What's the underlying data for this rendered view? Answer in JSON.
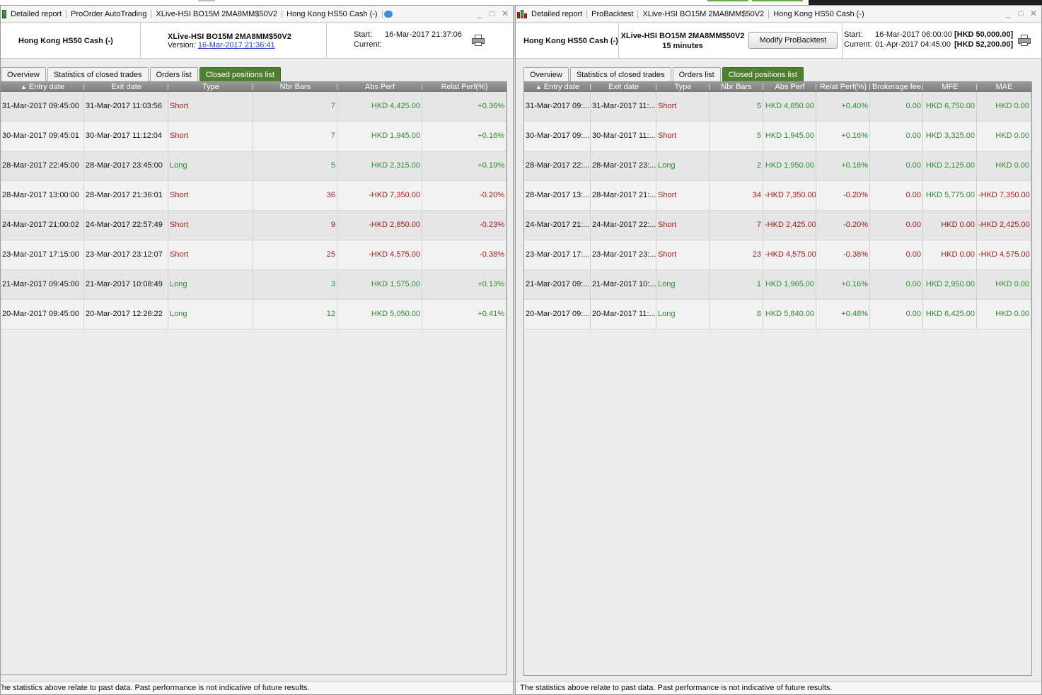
{
  "left": {
    "title_parts": [
      "Detailed report",
      "ProOrder AutoTrading",
      "XLive-HSI BO15M 2MA8MM$50V2",
      "Hong Kong HS50 Cash (-)"
    ],
    "instrument": "Hong Kong HS50 Cash (-)",
    "system_name": "XLive-HSI BO15M 2MA8MM$50V2",
    "version_label": "Version:",
    "version_value": "16-Mar-2017 21:36:41",
    "start_label": "Start:",
    "start_value": "16-Mar-2017 21:37:06",
    "current_label": "Current:",
    "tabs": [
      "Overview",
      "Statistics of closed trades",
      "Orders list",
      "Closed positions list"
    ],
    "active_tab": "Closed positions list",
    "columns": [
      "Entry date",
      "Exit date",
      "Type",
      "Nbr Bars",
      "Abs Perf",
      "Relat Perf(%)"
    ],
    "rows": [
      [
        "31-Mar-2017 09:45:00",
        "31-Mar-2017 11:03:56",
        "Short",
        "7",
        "HKD 4,425.00",
        "+0.36%"
      ],
      [
        "30-Mar-2017 09:45:01",
        "30-Mar-2017 11:12:04",
        "Short",
        "7",
        "HKD 1,945.00",
        "+0.16%"
      ],
      [
        "28-Mar-2017 22:45:00",
        "28-Mar-2017 23:45:00",
        "Long",
        "5",
        "HKD 2,315.00",
        "+0.19%"
      ],
      [
        "28-Mar-2017 13:00:00",
        "28-Mar-2017 21:36:01",
        "Short",
        "36",
        "-HKD 7,350.00",
        "-0.20%"
      ],
      [
        "24-Mar-2017 21:00:02",
        "24-Mar-2017 22:57:49",
        "Short",
        "9",
        "-HKD 2,850.00",
        "-0.23%"
      ],
      [
        "23-Mar-2017 17:15:00",
        "23-Mar-2017 23:12:07",
        "Short",
        "25",
        "-HKD 4,575.00",
        "-0.38%"
      ],
      [
        "21-Mar-2017 09:45:00",
        "21-Mar-2017 10:08:49",
        "Long",
        "3",
        "HKD 1,575.00",
        "+0.13%"
      ],
      [
        "20-Mar-2017 09:45:00",
        "20-Mar-2017 12:26:22",
        "Long",
        "12",
        "HKD 5,050.00",
        "+0.41%"
      ]
    ],
    "footer": "The statistics above relate to past data. Past performance is not indicative of future results."
  },
  "right": {
    "title_parts": [
      "Detailed report",
      "ProBacktest",
      "XLive-HSI BO15M 2MA8MM$50V2",
      "Hong Kong HS50 Cash (-)"
    ],
    "instrument": "Hong Kong HS50 Cash (-)",
    "system_name": "XLive-HSI BO15M 2MA8MM$50V2",
    "timeframe": "15 minutes",
    "modify_button": "Modify ProBacktest",
    "start_label": "Start:",
    "start_value": "16-Mar-2017 06:00:00",
    "start_capital": "[HKD 50,000.00]",
    "current_label": "Current:",
    "current_value": "01-Apr-2017 04:45:00",
    "current_capital": "[HKD 52,200.00]",
    "tabs": [
      "Overview",
      "Statistics of closed trades",
      "Orders list",
      "Closed positions list"
    ],
    "active_tab": "Closed positions list",
    "columns": [
      "Entry date",
      "Exit date",
      "Type",
      "Nbr Bars",
      "Abs Perf",
      "Relat Perf(%)",
      "Brokerage fee",
      "MFE",
      "MAE"
    ],
    "rows": [
      [
        "31-Mar-2017 09:...",
        "31-Mar-2017 11:...",
        "Short",
        "5",
        "HKD 4,850.00",
        "+0.40%",
        "0.00",
        "HKD 6,750.00",
        "HKD 0.00"
      ],
      [
        "30-Mar-2017 09:...",
        "30-Mar-2017 11:...",
        "Short",
        "5",
        "HKD 1,945.00",
        "+0.16%",
        "0.00",
        "HKD 3,325.00",
        "HKD 0.00"
      ],
      [
        "28-Mar-2017 22:...",
        "28-Mar-2017 23:...",
        "Long",
        "2",
        "HKD 1,950.00",
        "+0.16%",
        "0.00",
        "HKD 2,125.00",
        "HKD 0.00"
      ],
      [
        "28-Mar-2017 13:...",
        "28-Mar-2017 21:...",
        "Short",
        "34",
        "-HKD 7,350.00",
        "-0.20%",
        "0.00",
        "HKD 5,775.00",
        "-HKD 7,350.00"
      ],
      [
        "24-Mar-2017 21:...",
        "24-Mar-2017 22:...",
        "Short",
        "7",
        "-HKD 2,425.00",
        "-0.20%",
        "0.00",
        "HKD 0.00",
        "-HKD 2,425.00"
      ],
      [
        "23-Mar-2017 17:...",
        "23-Mar-2017 23:...",
        "Short",
        "23",
        "-HKD 4,575.00",
        "-0.38%",
        "0.00",
        "HKD 0.00",
        "-HKD 4,575.00"
      ],
      [
        "21-Mar-2017 09:...",
        "21-Mar-2017 10:...",
        "Long",
        "1",
        "HKD 1,965.00",
        "+0.16%",
        "0.00",
        "HKD 2,950.00",
        "HKD 0.00"
      ],
      [
        "20-Mar-2017 09:...",
        "20-Mar-2017 11:...",
        "Long",
        "8",
        "HKD 5,840.00",
        "+0.48%",
        "0.00",
        "HKD 6,425.00",
        "HKD 0.00"
      ]
    ],
    "footer": "The statistics above relate to past data. Past performance is not indicative of future results."
  },
  "colors": {
    "positive": "#2e8b2e",
    "negative": "#a01c1c",
    "active_tab": "#4f7f31"
  },
  "icons": {
    "window_left": "strategy-icon",
    "window_right": "backtest-chart-icon",
    "chat": "chat-bubble-icon",
    "print": "printer-icon",
    "sort": "sort-up-arrow-icon"
  }
}
